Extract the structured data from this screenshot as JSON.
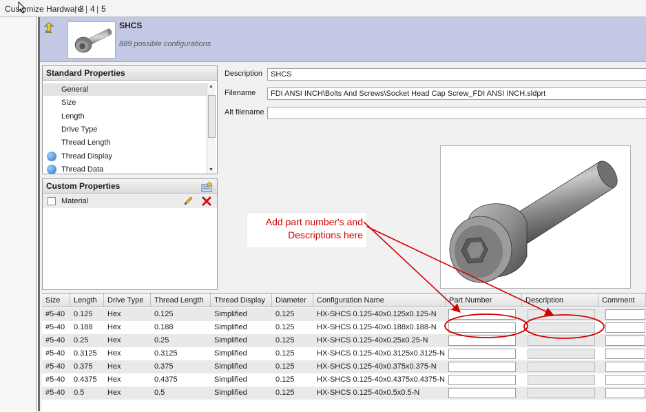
{
  "tabbar": {
    "breadcrumb": "Customize Hardware",
    "tabs": [
      "3",
      "4",
      "5"
    ]
  },
  "header": {
    "title": "SHCS",
    "subtitle": "889 possible configurations"
  },
  "standard_properties": {
    "title": "Standard Properties",
    "items": [
      {
        "label": "General",
        "icon": ""
      },
      {
        "label": "Size",
        "icon": ""
      },
      {
        "label": "Length",
        "icon": ""
      },
      {
        "label": "Drive Type",
        "icon": ""
      },
      {
        "label": "Thread Length",
        "icon": ""
      },
      {
        "label": "Thread Display",
        "icon": "globe-icon"
      },
      {
        "label": "Thread Data",
        "icon": "globe-icon"
      }
    ]
  },
  "custom_properties": {
    "title": "Custom Properties",
    "items": [
      {
        "label": "Material"
      }
    ]
  },
  "fields": {
    "description_label": "Description",
    "description_value": "SHCS",
    "filename_label": "Filename",
    "filename_value": "FDI ANSI INCH\\Bolts And Screws\\Socket Head Cap Screw_FDI ANSI INCH.sldprt",
    "alt_filename_label": "Alt filename",
    "alt_filename_value": ""
  },
  "annotation": {
    "line1": "Add part number's and",
    "line2": "Descriptions here"
  },
  "table": {
    "columns": [
      "Size",
      "Length",
      "Drive Type",
      "Thread Length",
      "Thread Display",
      "Diameter",
      "Configuration Name",
      "Part Number",
      "Description",
      "Comment"
    ],
    "rows": [
      [
        "#5-40",
        "0.125",
        "Hex",
        "0.125",
        "Simplified",
        "0.125",
        "HX-SHCS 0.125-40x0.125x0.125-N"
      ],
      [
        "#5-40",
        "0.188",
        "Hex",
        "0.188",
        "Simplified",
        "0.125",
        "HX-SHCS 0.125-40x0.188x0.188-N"
      ],
      [
        "#5-40",
        "0.25",
        "Hex",
        "0.25",
        "Simplified",
        "0.125",
        "HX-SHCS 0.125-40x0.25x0.25-N"
      ],
      [
        "#5-40",
        "0.3125",
        "Hex",
        "0.3125",
        "Simplified",
        "0.125",
        "HX-SHCS 0.125-40x0.3125x0.3125-N"
      ],
      [
        "#5-40",
        "0.375",
        "Hex",
        "0.375",
        "Simplified",
        "0.125",
        "HX-SHCS 0.125-40x0.375x0.375-N"
      ],
      [
        "#5-40",
        "0.4375",
        "Hex",
        "0.4375",
        "Simplified",
        "0.125",
        "HX-SHCS 0.125-40x0.4375x0.4375-N"
      ],
      [
        "#5-40",
        "0.5",
        "Hex",
        "0.5",
        "Simplified",
        "0.125",
        "HX-SHCS 0.125-40x0.5x0.5-N"
      ]
    ]
  },
  "colors": {
    "header_bg": "#c3c9e4",
    "annotation_red": "#d00000"
  }
}
